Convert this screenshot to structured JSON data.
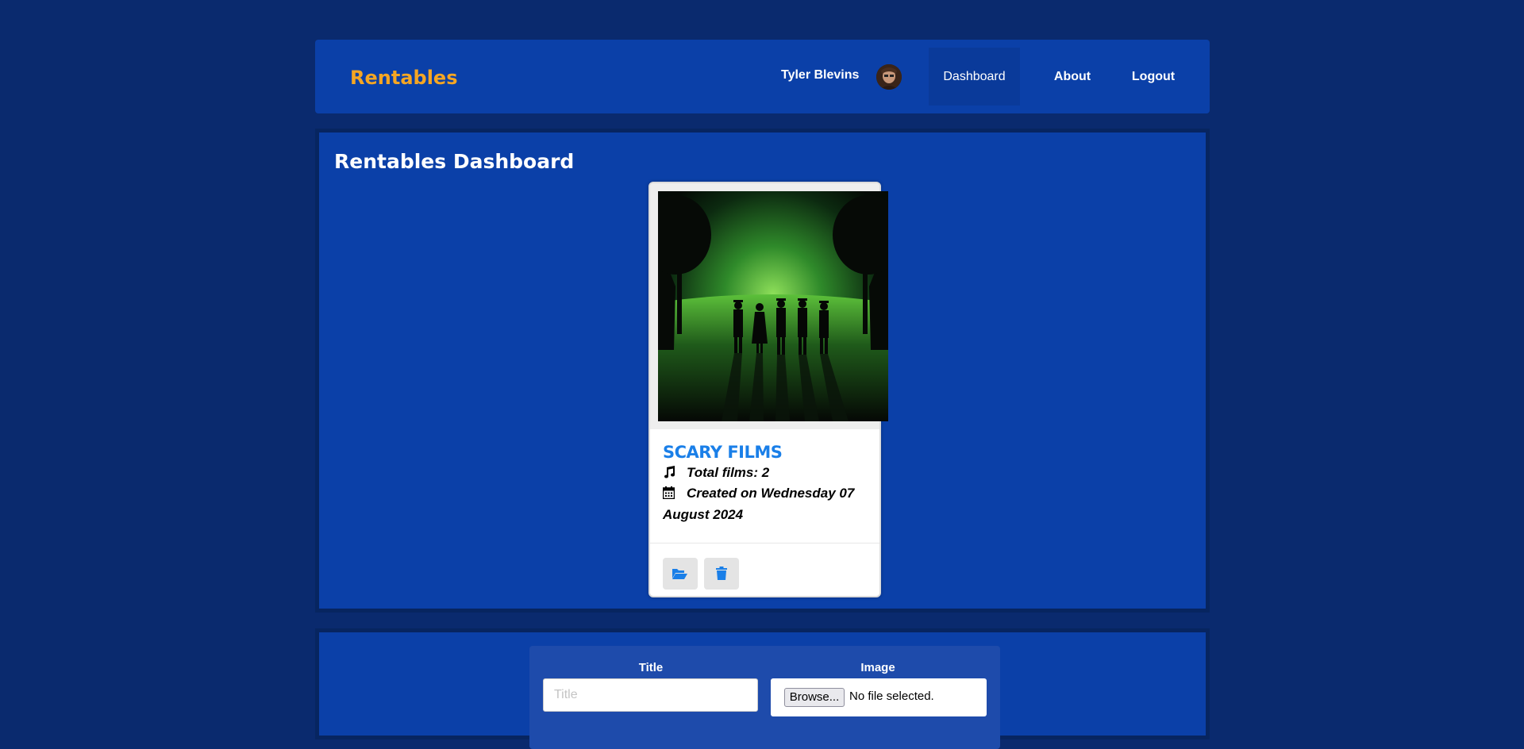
{
  "navbar": {
    "brand": "Rentables",
    "user_name": "Tyler Blevins",
    "links": {
      "dashboard": "Dashboard",
      "about": "About",
      "logout": "Logout"
    }
  },
  "dashboard": {
    "title": "Rentables Dashboard",
    "card": {
      "title": "SCARY FILMS",
      "total_films": "Total films: 2",
      "created_on": "Created on Wednesday 07 August 2024",
      "icons": {
        "music": "music-note-icon",
        "calendar": "calendar-icon",
        "open": "folder-open-icon",
        "delete": "trash-icon"
      }
    }
  },
  "form": {
    "title_label": "Title",
    "title_placeholder": "Title",
    "title_value": "",
    "image_label": "Image",
    "browse_label": "Browse...",
    "file_status": "No file selected."
  },
  "colors": {
    "page_bg": "#0a2a6e",
    "panel_bg": "#0b40a8",
    "brand": "#f5a623",
    "card_title": "#1a7fe8"
  }
}
